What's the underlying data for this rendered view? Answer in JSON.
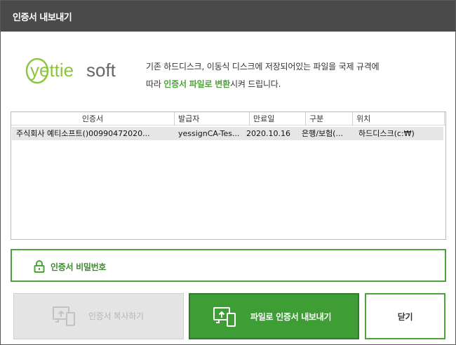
{
  "window": {
    "title": "인증서 내보내기"
  },
  "logo": {
    "text_left": "yettie",
    "text_right": "soft"
  },
  "description": {
    "line1": "기존 하드디스크, 이동식 디스크에 저장되어있는 파일을 국제 규격에",
    "line2_prefix": "따라 ",
    "line2_highlight": "인증서 파일로 변환",
    "line2_suffix": "시켜 드립니다."
  },
  "cert_table": {
    "columns": [
      "인증서",
      "발급자",
      "만료일",
      "구분",
      "위치"
    ],
    "rows": [
      [
        "주식회사 예티소프트()00990472020...",
        "yessignCA-Tes...",
        "2020.10.16",
        "은행/보험(...",
        "하드디스크(c:₩)"
      ]
    ]
  },
  "password": {
    "label": "인증서 비밀번호"
  },
  "buttons": {
    "copy_label": "인증서 복사하기",
    "export_label": "파일로 인증서 내보내기",
    "close_label": "닫기"
  },
  "colors": {
    "accent": "#4ba33a",
    "titlebar": "#4a4a4a",
    "export_bg": "#3f9d36"
  }
}
